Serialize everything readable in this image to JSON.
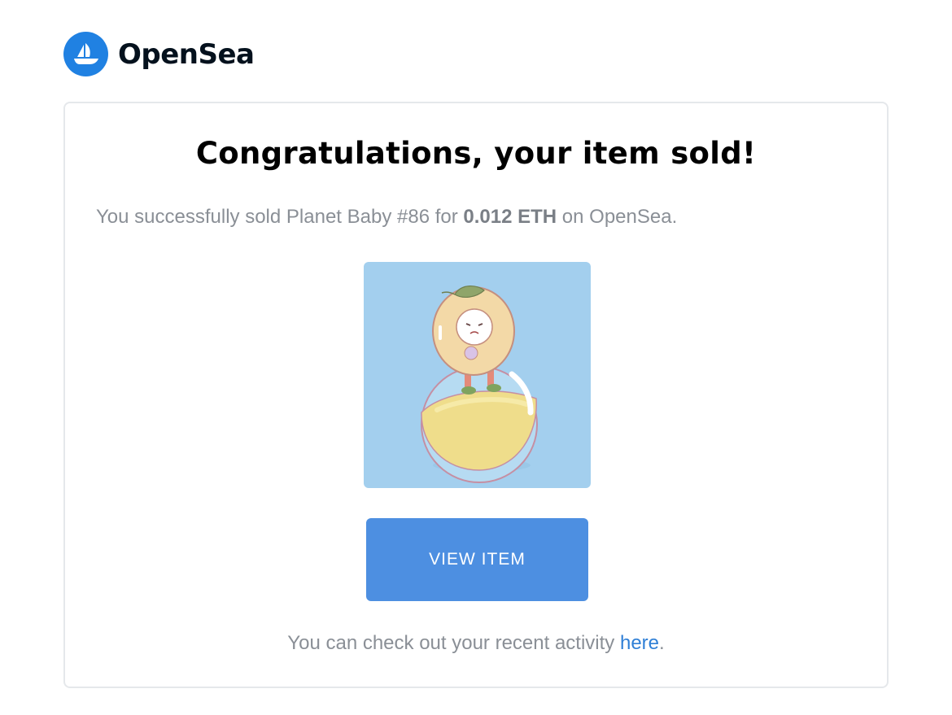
{
  "brand": {
    "name": "OpenSea",
    "logo_icon": "opensea-ship-icon",
    "color": "#2081e2"
  },
  "card": {
    "title": "Congratulations, your item sold!",
    "message": {
      "prefix": "You successfully sold Planet Baby #86 for",
      "price": "0.012 ETH",
      "suffix": "on OpenSea."
    },
    "item_image": {
      "icon": "planet-baby-nft-artwork",
      "background_color": "#a3cfee"
    },
    "button": {
      "label": "VIEW ITEM",
      "color": "#4d8fe1"
    },
    "activity": {
      "prefix": "You can check out your recent activity",
      "link_text": "here",
      "suffix": ".",
      "link_color": "#2f7fd6"
    }
  }
}
